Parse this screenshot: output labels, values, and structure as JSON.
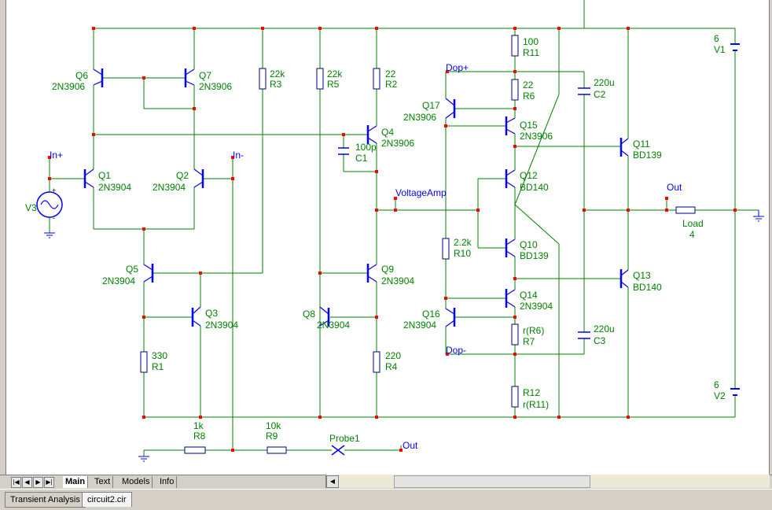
{
  "schematic": {
    "transistors": [
      {
        "ref": "Q1",
        "model": "2N3904"
      },
      {
        "ref": "Q2",
        "model": "2N3904"
      },
      {
        "ref": "Q3",
        "model": "2N3904"
      },
      {
        "ref": "Q4",
        "model": "2N3906"
      },
      {
        "ref": "Q5",
        "model": "2N3904"
      },
      {
        "ref": "Q6",
        "model": "2N3906"
      },
      {
        "ref": "Q7",
        "model": "2N3906"
      },
      {
        "ref": "Q8",
        "model": "2N3904"
      },
      {
        "ref": "Q9",
        "model": "2N3904"
      },
      {
        "ref": "Q10",
        "model": "BD139"
      },
      {
        "ref": "Q11",
        "model": "BD139"
      },
      {
        "ref": "Q12",
        "model": "BD140"
      },
      {
        "ref": "Q13",
        "model": "BD140"
      },
      {
        "ref": "Q14",
        "model": "2N3904"
      },
      {
        "ref": "Q15",
        "model": "2N3906"
      },
      {
        "ref": "Q16",
        "model": "2N3904"
      },
      {
        "ref": "Q17",
        "model": "2N3906"
      }
    ],
    "resistors": [
      {
        "ref": "R1",
        "value": "330"
      },
      {
        "ref": "R2",
        "value": "22"
      },
      {
        "ref": "R3",
        "value": "22k"
      },
      {
        "ref": "R4",
        "value": "220"
      },
      {
        "ref": "R5",
        "value": "22k"
      },
      {
        "ref": "R6",
        "value": "22"
      },
      {
        "ref": "R7",
        "value": "r(R6)"
      },
      {
        "ref": "R8",
        "value": "1k"
      },
      {
        "ref": "R9",
        "value": "10k"
      },
      {
        "ref": "R10",
        "value": "2.2k"
      },
      {
        "ref": "R11",
        "value": "100"
      },
      {
        "ref": "R12",
        "value": "r(R11)"
      }
    ],
    "load": {
      "ref": "Load",
      "value": "4"
    },
    "capacitors": [
      {
        "ref": "C1",
        "value": "100p"
      },
      {
        "ref": "C2",
        "value": "220u"
      },
      {
        "ref": "C3",
        "value": "220u"
      }
    ],
    "sources": [
      {
        "ref": "V1",
        "value": "6"
      },
      {
        "ref": "V2",
        "value": "6"
      },
      {
        "ref": "V3",
        "plus": "+",
        "minus": "-"
      }
    ],
    "nodes": {
      "in_plus": "In+",
      "in_minus": "In-",
      "voltage_amp": "VoltageAmp",
      "dop_plus": "Dop+",
      "dop_minus": "Dop-",
      "out_top": "Out",
      "out_bottom": "Out"
    },
    "probe": "Probe1"
  },
  "tabs": [
    "Main",
    "Text",
    "Models",
    "Info"
  ],
  "active_tab": "Main",
  "bottom_tabs": [
    "Transient Analysis",
    "circuit2.cir"
  ],
  "active_bottom_tab": "circuit2.cir",
  "colors": {
    "wire": "#008000",
    "component": "#0000ff",
    "node_dot": "#ff0000",
    "label": "#008000",
    "node_label": "#0000ff"
  }
}
